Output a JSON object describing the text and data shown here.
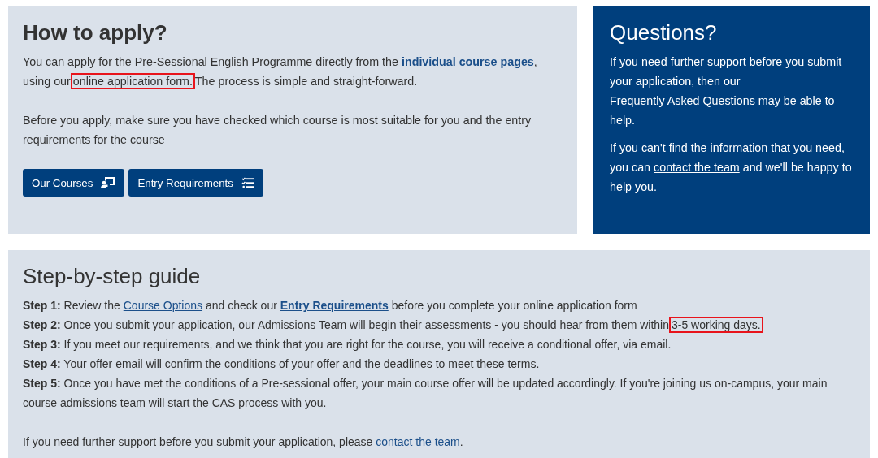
{
  "apply": {
    "title": "How to apply?",
    "paragraphs": [
      [
        {
          "kind": "text",
          "text": "You can apply for the Pre-Sessional English Programme directly from the "
        },
        {
          "kind": "strong-link",
          "text": "individual course pages"
        },
        {
          "kind": "text",
          "text": ", using our"
        },
        {
          "kind": "marked",
          "text": "online application form."
        },
        {
          "kind": "text",
          "text": "The process is simple and straight-forward."
        }
      ],
      [
        {
          "kind": "text",
          "text": "Before you apply, make sure you have checked which course is most suitable for you and the entry requirements for the course"
        }
      ]
    ],
    "buttons": [
      {
        "label": "Our Courses",
        "kind": "presenter"
      },
      {
        "label": "Entry Requirements",
        "kind": "checklist"
      }
    ]
  },
  "questions": {
    "title": "Questions?",
    "paragraphs": [
      [
        {
          "kind": "text",
          "text": "If you need further support before you submit your application, then our "
        },
        {
          "kind": "link",
          "text": "Frequently Asked Questions"
        },
        {
          "kind": "text",
          "text": " may be able to help."
        }
      ],
      [
        {
          "kind": "text",
          "text": "If you can't find the information that you need, you can "
        },
        {
          "kind": "link",
          "text": "contact the team"
        },
        {
          "kind": "text",
          "text": " and we'll be happy to help you."
        }
      ]
    ]
  },
  "guide": {
    "title": "Step-by-step guide",
    "steps": [
      [
        {
          "kind": "bold",
          "text": "Step 1:"
        },
        {
          "kind": "text",
          "text": " Review the "
        },
        {
          "kind": "link",
          "text": "Course Options"
        },
        {
          "kind": "text",
          "text": " and check our "
        },
        {
          "kind": "strong-link",
          "text": "Entry Requirements"
        },
        {
          "kind": "text",
          "text": " before you complete your online application form"
        }
      ],
      [
        {
          "kind": "bold",
          "text": "Step 2:"
        },
        {
          "kind": "text",
          "text": " Once you submit your application, our Admissions Team will begin their assessments - you should hear from them within"
        },
        {
          "kind": "marked",
          "text": "3-5 working days."
        }
      ],
      [
        {
          "kind": "bold",
          "text": "Step 3:"
        },
        {
          "kind": "text",
          "text": " If you meet our requirements, and we think that you are right for the course, you will receive a conditional offer, via email."
        }
      ],
      [
        {
          "kind": "bold",
          "text": "Step 4:"
        },
        {
          "kind": "text",
          "text": " Your offer email will confirm the conditions of your offer and the deadlines to meet these terms."
        }
      ],
      [
        {
          "kind": "bold",
          "text": "Step 5:"
        },
        {
          "kind": "text",
          "text": " Once you have met the conditions of a Pre-sessional offer, your main course offer will be updated accordingly. If you're joining us on-campus, your main course admissions team will start the CAS process with you."
        }
      ]
    ],
    "footer": [
      {
        "kind": "text",
        "text": "If you need further support before you submit your application, please "
      },
      {
        "kind": "link",
        "text": "contact the team"
      },
      {
        "kind": "text",
        "text": "."
      }
    ]
  }
}
